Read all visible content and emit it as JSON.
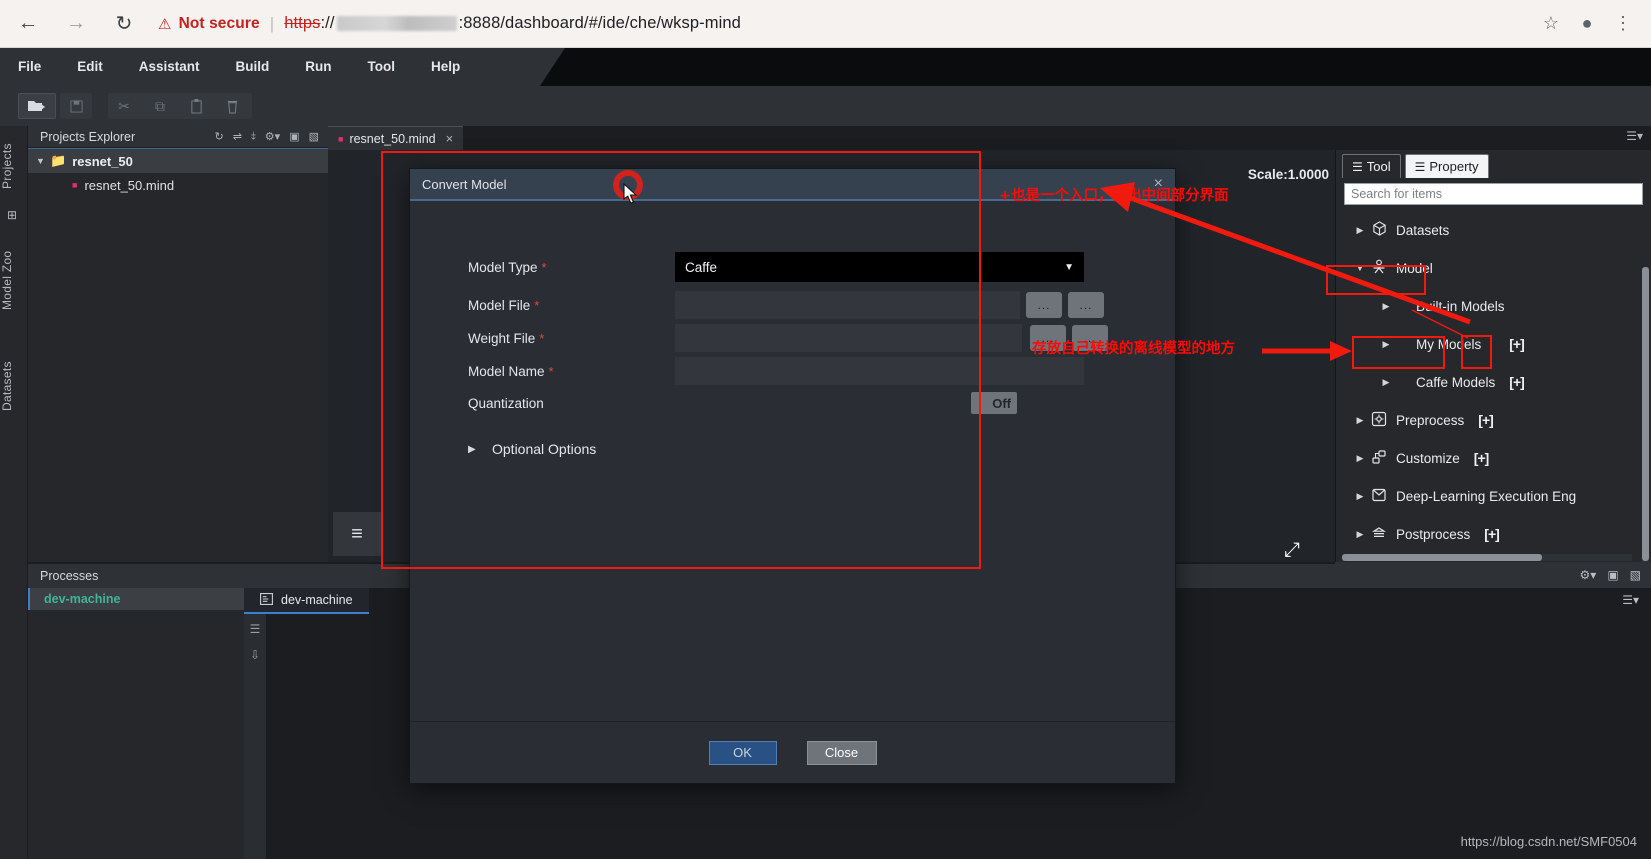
{
  "browser": {
    "back_icon": "arrow-left",
    "forward_icon": "arrow-right",
    "reload_icon": "reload",
    "security_warning_icon": "warning-triangle",
    "security_label": "Not secure",
    "url_scheme": "https",
    "url_scheme_suffix": "://",
    "url_rest": ":8888/dashboard/#/ide/che/wksp-mind",
    "star_icon": "star",
    "profile_icon": "profile",
    "menu_icon": "kebab-menu"
  },
  "menubar": {
    "items": [
      {
        "label": "File"
      },
      {
        "label": "Edit"
      },
      {
        "label": "Assistant"
      },
      {
        "label": "Build"
      },
      {
        "label": "Run"
      },
      {
        "label": "Tool"
      },
      {
        "label": "Help"
      }
    ]
  },
  "toolbar": {
    "buttons": [
      {
        "name": "new-project-icon",
        "glyph": "📁",
        "state": "enabled"
      },
      {
        "name": "save-icon",
        "glyph": "💾",
        "state": "disabled"
      },
      {
        "name": "cut-icon",
        "glyph": "✂",
        "state": "disabled"
      },
      {
        "name": "copy-icon",
        "glyph": "⧉",
        "state": "disabled"
      },
      {
        "name": "paste-icon",
        "glyph": "📋",
        "state": "disabled"
      },
      {
        "name": "delete-icon",
        "glyph": "🗑",
        "state": "disabled"
      }
    ]
  },
  "rail": {
    "items": [
      {
        "label": "Projects"
      },
      {
        "label": "Model Zoo"
      },
      {
        "label": "Datasets"
      }
    ]
  },
  "projects_explorer": {
    "title": "Projects Explorer",
    "header_icons": [
      "refresh-icon",
      "link-icon",
      "collapse-icon",
      "gear-icon",
      "maximize-icon",
      "restore-icon"
    ],
    "tree": [
      {
        "label": "resnet_50",
        "type": "folder",
        "expanded": true,
        "selected": true
      },
      {
        "label": "resnet_50.mind",
        "type": "file",
        "expanded": false,
        "selected": false
      }
    ]
  },
  "editor": {
    "tab_label": "resnet_50.mind",
    "tab_close": "×",
    "scale_label": "Scale:1.0000",
    "palette_icon": "list-icon",
    "fit_icon": "fit-to-screen-icon"
  },
  "right_panel": {
    "tabs": [
      {
        "label": "Tool",
        "active": true
      },
      {
        "label": "Property",
        "active": false
      }
    ],
    "search_placeholder": "Search for items",
    "search_value": "",
    "tree": [
      {
        "label": "Datasets",
        "icon": "cube-icon",
        "indent": 0,
        "expanded": false,
        "plus": false,
        "highlight": false
      },
      {
        "label": "Model",
        "icon": "model-icon",
        "indent": 0,
        "expanded": true,
        "plus": false,
        "highlight": true
      },
      {
        "label": "Built-in Models",
        "icon": "",
        "indent": 1,
        "expanded": false,
        "plus": false,
        "highlight": false
      },
      {
        "label": "My Models",
        "icon": "",
        "indent": 1,
        "expanded": false,
        "plus": true,
        "highlight": true
      },
      {
        "label": "Caffe Models",
        "icon": "",
        "indent": 1,
        "expanded": false,
        "plus": true,
        "highlight": false
      },
      {
        "label": "Preprocess",
        "icon": "preprocess-icon",
        "indent": 0,
        "expanded": false,
        "plus": true,
        "highlight": false
      },
      {
        "label": "Customize",
        "icon": "customize-icon",
        "indent": 0,
        "expanded": false,
        "plus": true,
        "highlight": false
      },
      {
        "label": "Deep-Learning Execution Eng",
        "icon": "engine-icon",
        "indent": 0,
        "expanded": false,
        "plus": false,
        "highlight": false
      },
      {
        "label": "Postprocess",
        "icon": "postprocess-icon",
        "indent": 0,
        "expanded": false,
        "plus": true,
        "highlight": false
      }
    ],
    "plus_label": "[+]",
    "bottom_icons": [
      "gear-icon",
      "minimize-icon",
      "maximize-icon"
    ]
  },
  "processes": {
    "title": "Processes",
    "list": [
      {
        "label": "dev-machine",
        "selected": true
      }
    ],
    "tab": {
      "label": "dev-machine",
      "icon": "terminal-icon"
    },
    "panel_menu_icon": "hamburger-icon",
    "side_icons": [
      "wrap-icon",
      "download-icon"
    ]
  },
  "dialog": {
    "title": "Convert Model",
    "close_icon": "×",
    "fields": [
      {
        "label": "Model Type",
        "required": true,
        "kind": "select",
        "value": "Caffe"
      },
      {
        "label": "Model File",
        "required": true,
        "kind": "file",
        "value": ""
      },
      {
        "label": "Weight File",
        "required": true,
        "kind": "file",
        "value": ""
      },
      {
        "label": "Model Name",
        "required": true,
        "kind": "text",
        "value": ""
      },
      {
        "label": "Quantization",
        "required": false,
        "kind": "toggle",
        "value": "Off"
      }
    ],
    "dots_label": "...",
    "optional_options_label": "Optional Options",
    "ok_label": "OK",
    "close_label": "Close"
  },
  "annotations": {
    "note_top": "+也是一个入口，弹出中间部分界面",
    "note_models": "存放自己转换的离线模型的地方"
  },
  "watermark": "https://blog.csdn.net/SMF0504",
  "colors": {
    "accent_blue": "#3f7fd0",
    "annotation_red": "#fb0b06",
    "warning_red": "#c5221f",
    "folder_yellow": "#e8b339",
    "process_green": "#3fb59a"
  }
}
